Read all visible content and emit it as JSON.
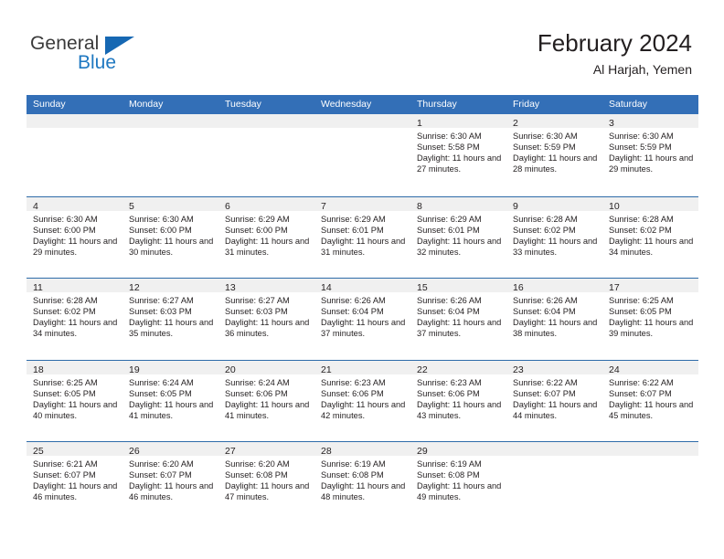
{
  "logo": {
    "top_text": "General",
    "bottom_text": "Blue",
    "triangle_color": "#1668b3",
    "blue_color": "#1f78c1"
  },
  "header": {
    "title": "February 2024",
    "location": "Al Harjah, Yemen"
  },
  "colors": {
    "header_row_bg": "#336fb7",
    "header_row_text": "#ffffff",
    "row_divider": "#2e6ca9",
    "day_number_band": "#f0f0f0",
    "body_text": "#231f20"
  },
  "weekdays": [
    "Sunday",
    "Monday",
    "Tuesday",
    "Wednesday",
    "Thursday",
    "Friday",
    "Saturday"
  ],
  "labels": {
    "sunrise_prefix": "Sunrise:",
    "sunset_prefix": "Sunset:",
    "daylight_prefix": "Daylight:"
  },
  "weeks": [
    [
      {
        "day": "",
        "empty": true
      },
      {
        "day": "",
        "empty": true
      },
      {
        "day": "",
        "empty": true
      },
      {
        "day": "",
        "empty": true
      },
      {
        "day": "1",
        "sunrise": "Sunrise: 6:30 AM",
        "sunset": "Sunset: 5:58 PM",
        "daylight": "Daylight: 11 hours and 27 minutes."
      },
      {
        "day": "2",
        "sunrise": "Sunrise: 6:30 AM",
        "sunset": "Sunset: 5:59 PM",
        "daylight": "Daylight: 11 hours and 28 minutes."
      },
      {
        "day": "3",
        "sunrise": "Sunrise: 6:30 AM",
        "sunset": "Sunset: 5:59 PM",
        "daylight": "Daylight: 11 hours and 29 minutes."
      }
    ],
    [
      {
        "day": "4",
        "sunrise": "Sunrise: 6:30 AM",
        "sunset": "Sunset: 6:00 PM",
        "daylight": "Daylight: 11 hours and 29 minutes."
      },
      {
        "day": "5",
        "sunrise": "Sunrise: 6:30 AM",
        "sunset": "Sunset: 6:00 PM",
        "daylight": "Daylight: 11 hours and 30 minutes."
      },
      {
        "day": "6",
        "sunrise": "Sunrise: 6:29 AM",
        "sunset": "Sunset: 6:00 PM",
        "daylight": "Daylight: 11 hours and 31 minutes."
      },
      {
        "day": "7",
        "sunrise": "Sunrise: 6:29 AM",
        "sunset": "Sunset: 6:01 PM",
        "daylight": "Daylight: 11 hours and 31 minutes."
      },
      {
        "day": "8",
        "sunrise": "Sunrise: 6:29 AM",
        "sunset": "Sunset: 6:01 PM",
        "daylight": "Daylight: 11 hours and 32 minutes."
      },
      {
        "day": "9",
        "sunrise": "Sunrise: 6:28 AM",
        "sunset": "Sunset: 6:02 PM",
        "daylight": "Daylight: 11 hours and 33 minutes."
      },
      {
        "day": "10",
        "sunrise": "Sunrise: 6:28 AM",
        "sunset": "Sunset: 6:02 PM",
        "daylight": "Daylight: 11 hours and 34 minutes."
      }
    ],
    [
      {
        "day": "11",
        "sunrise": "Sunrise: 6:28 AM",
        "sunset": "Sunset: 6:02 PM",
        "daylight": "Daylight: 11 hours and 34 minutes."
      },
      {
        "day": "12",
        "sunrise": "Sunrise: 6:27 AM",
        "sunset": "Sunset: 6:03 PM",
        "daylight": "Daylight: 11 hours and 35 minutes."
      },
      {
        "day": "13",
        "sunrise": "Sunrise: 6:27 AM",
        "sunset": "Sunset: 6:03 PM",
        "daylight": "Daylight: 11 hours and 36 minutes."
      },
      {
        "day": "14",
        "sunrise": "Sunrise: 6:26 AM",
        "sunset": "Sunset: 6:04 PM",
        "daylight": "Daylight: 11 hours and 37 minutes."
      },
      {
        "day": "15",
        "sunrise": "Sunrise: 6:26 AM",
        "sunset": "Sunset: 6:04 PM",
        "daylight": "Daylight: 11 hours and 37 minutes."
      },
      {
        "day": "16",
        "sunrise": "Sunrise: 6:26 AM",
        "sunset": "Sunset: 6:04 PM",
        "daylight": "Daylight: 11 hours and 38 minutes."
      },
      {
        "day": "17",
        "sunrise": "Sunrise: 6:25 AM",
        "sunset": "Sunset: 6:05 PM",
        "daylight": "Daylight: 11 hours and 39 minutes."
      }
    ],
    [
      {
        "day": "18",
        "sunrise": "Sunrise: 6:25 AM",
        "sunset": "Sunset: 6:05 PM",
        "daylight": "Daylight: 11 hours and 40 minutes."
      },
      {
        "day": "19",
        "sunrise": "Sunrise: 6:24 AM",
        "sunset": "Sunset: 6:05 PM",
        "daylight": "Daylight: 11 hours and 41 minutes."
      },
      {
        "day": "20",
        "sunrise": "Sunrise: 6:24 AM",
        "sunset": "Sunset: 6:06 PM",
        "daylight": "Daylight: 11 hours and 41 minutes."
      },
      {
        "day": "21",
        "sunrise": "Sunrise: 6:23 AM",
        "sunset": "Sunset: 6:06 PM",
        "daylight": "Daylight: 11 hours and 42 minutes."
      },
      {
        "day": "22",
        "sunrise": "Sunrise: 6:23 AM",
        "sunset": "Sunset: 6:06 PM",
        "daylight": "Daylight: 11 hours and 43 minutes."
      },
      {
        "day": "23",
        "sunrise": "Sunrise: 6:22 AM",
        "sunset": "Sunset: 6:07 PM",
        "daylight": "Daylight: 11 hours and 44 minutes."
      },
      {
        "day": "24",
        "sunrise": "Sunrise: 6:22 AM",
        "sunset": "Sunset: 6:07 PM",
        "daylight": "Daylight: 11 hours and 45 minutes."
      }
    ],
    [
      {
        "day": "25",
        "sunrise": "Sunrise: 6:21 AM",
        "sunset": "Sunset: 6:07 PM",
        "daylight": "Daylight: 11 hours and 46 minutes."
      },
      {
        "day": "26",
        "sunrise": "Sunrise: 6:20 AM",
        "sunset": "Sunset: 6:07 PM",
        "daylight": "Daylight: 11 hours and 46 minutes."
      },
      {
        "day": "27",
        "sunrise": "Sunrise: 6:20 AM",
        "sunset": "Sunset: 6:08 PM",
        "daylight": "Daylight: 11 hours and 47 minutes."
      },
      {
        "day": "28",
        "sunrise": "Sunrise: 6:19 AM",
        "sunset": "Sunset: 6:08 PM",
        "daylight": "Daylight: 11 hours and 48 minutes."
      },
      {
        "day": "29",
        "sunrise": "Sunrise: 6:19 AM",
        "sunset": "Sunset: 6:08 PM",
        "daylight": "Daylight: 11 hours and 49 minutes."
      },
      {
        "day": "",
        "empty": true
      },
      {
        "day": "",
        "empty": true
      }
    ]
  ]
}
